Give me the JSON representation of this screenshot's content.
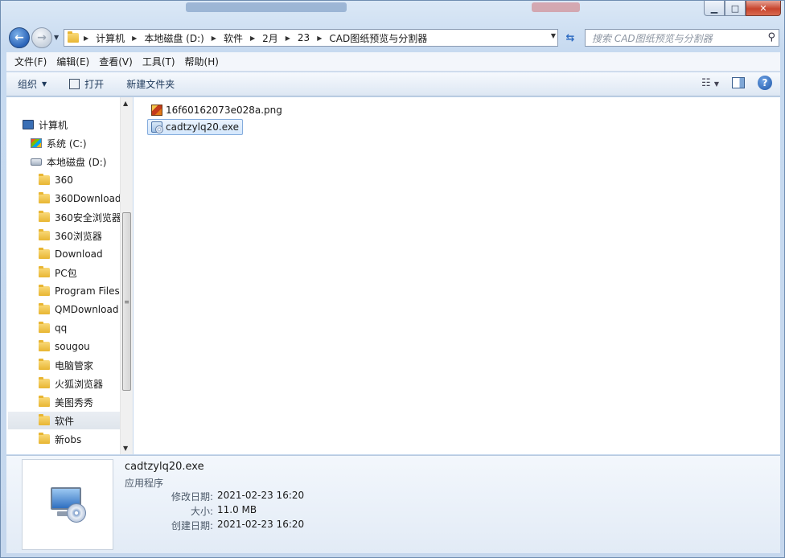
{
  "window": {
    "caption": {
      "minimize": "▁",
      "maximize": "□",
      "close": "✕"
    }
  },
  "address": {
    "crumbs": [
      "计算机",
      "本地磁盘 (D:)",
      "软件",
      "2月",
      "23",
      "CAD图纸预览与分割器"
    ],
    "search_placeholder": "搜索 CAD图纸预览与分割器"
  },
  "menubar": {
    "items": [
      "文件(F)",
      "编辑(E)",
      "查看(V)",
      "工具(T)",
      "帮助(H)"
    ]
  },
  "commandbar": {
    "organize": "组织",
    "open": "打开",
    "new_folder": "新建文件夹"
  },
  "nav": {
    "computer": "计算机",
    "drive_c": "系统 (C:)",
    "drive_d": "本地磁盘 (D:)",
    "folders": [
      "360",
      "360Download",
      "360安全浏览器",
      "360浏览器",
      "Download",
      "PC包",
      "Program Files",
      "QMDownload",
      "qq",
      "sougou",
      "电脑管家",
      "火狐浏览器",
      "美图秀秀",
      "软件",
      "新obs"
    ],
    "selected_folder": "软件"
  },
  "files": [
    {
      "name": "16f60162073e028a.png",
      "icon": "image-file-icon",
      "selected": false
    },
    {
      "name": "cadtzylq20.exe",
      "icon": "exe-file-icon",
      "selected": true
    }
  ],
  "details": {
    "name": "cadtzylq20.exe",
    "type": "应用程序",
    "modified_label": "修改日期:",
    "modified_value": "2021-02-23 16:20",
    "size_label": "大小:",
    "size_value": "11.0 MB",
    "created_label": "创建日期:",
    "created_value": "2021-02-23 16:20"
  }
}
